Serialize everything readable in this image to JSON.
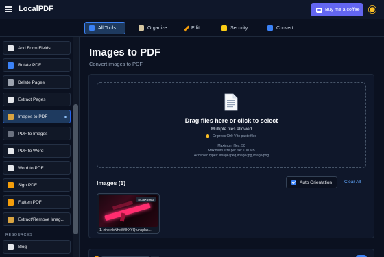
{
  "header": {
    "brand": "LocalPDF",
    "coffee_label": "Buy me a coffee",
    "accent": "#6366f1"
  },
  "tabs": [
    {
      "label": "All Tools",
      "icon": "grid-icon",
      "active": true
    },
    {
      "label": "Organize",
      "icon": "organize-icon",
      "active": false
    },
    {
      "label": "Edit",
      "icon": "pencil-icon",
      "active": false
    },
    {
      "label": "Security",
      "icon": "lock-icon",
      "active": false
    },
    {
      "label": "Convert",
      "icon": "convert-icon",
      "active": false
    }
  ],
  "sidebar": {
    "items": [
      {
        "label": "Add Form Fields",
        "icon": "form-icon"
      },
      {
        "label": "Rotate PDF",
        "icon": "rotate-icon"
      },
      {
        "label": "Delete Pages",
        "icon": "trash-icon"
      },
      {
        "label": "Extract Pages",
        "icon": "extract-icon"
      },
      {
        "label": "Images to PDF",
        "icon": "image-icon",
        "active": true
      },
      {
        "label": "PDF to Images",
        "icon": "camera-icon"
      },
      {
        "label": "PDF to Word",
        "icon": "document-icon"
      },
      {
        "label": "Word to PDF",
        "icon": "document-icon"
      },
      {
        "label": "Sign PDF",
        "icon": "signature-icon"
      },
      {
        "label": "Flatten PDF",
        "icon": "pencil-icon"
      },
      {
        "label": "Extract/Remove Imag...",
        "icon": "image-icon"
      }
    ],
    "resources_label": "RESOURCES",
    "blog_label": "Blog"
  },
  "main": {
    "title": "Images to PDF",
    "subtitle": "Convert images to PDF",
    "dropzone": {
      "title": "Drag files here or click to select",
      "multiple": "Multiple files allowed",
      "paste_hint": "Or press Ctrl+V to paste files",
      "max_files": "Maximum files: 50",
      "max_size": "Maximum size per file: 100 MB",
      "accepted": "Accepted types: image/jpeg,image/jpg,image/png"
    },
    "images_header": "Images (1)",
    "auto_orientation_label": "Auto Orientation",
    "auto_orientation_checked": true,
    "clear_all_label": "Clear All",
    "images": [
      {
        "dimensions": "8438×3963",
        "name": "1. zino-nbNHxW0hXYQ-unsplas..."
      }
    ]
  }
}
